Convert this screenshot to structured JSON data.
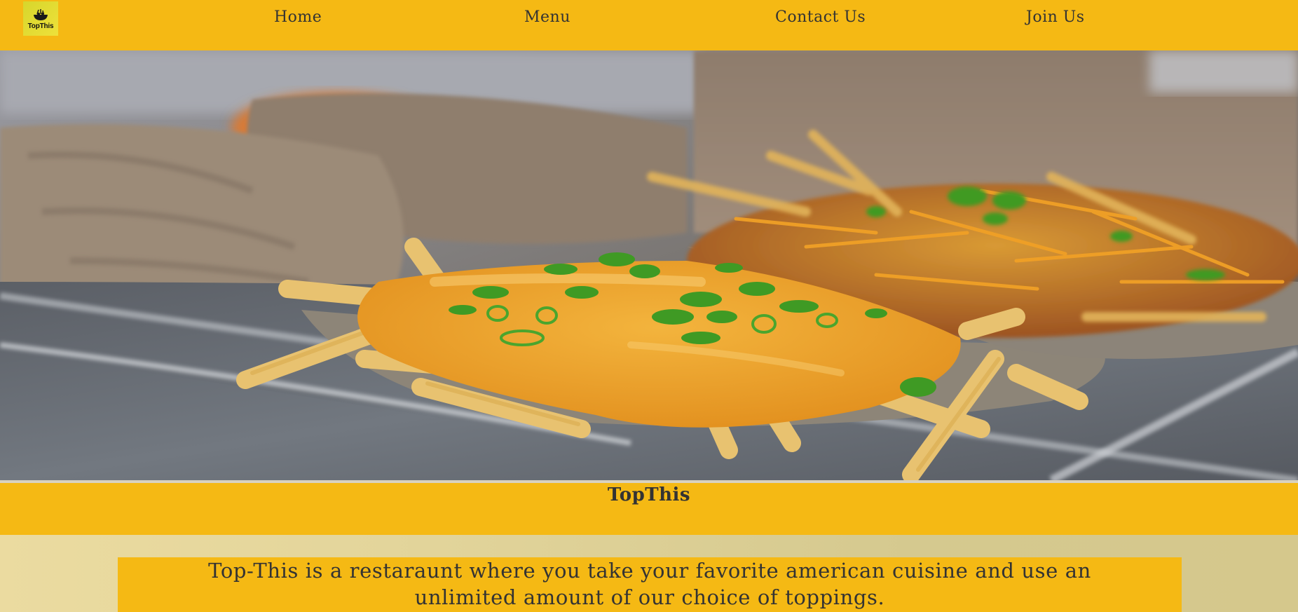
{
  "logo": {
    "text": "TopThis",
    "icon": "bowl-icon"
  },
  "nav": {
    "items": [
      {
        "label": "Home"
      },
      {
        "label": "Menu"
      },
      {
        "label": "Contact Us"
      },
      {
        "label": "Join Us"
      }
    ]
  },
  "hero": {
    "image": "cheese-fries-photo",
    "colors": {
      "tray": "#6f7379",
      "cheese": "#eba12a",
      "fries": "#e8c270",
      "scallion": "#3f9a24",
      "paper": "#9c8b78"
    }
  },
  "brand": {
    "title": "TopThis"
  },
  "about": {
    "text": "Top-This is a restaraunt where you take your favorite american cuisine and use an unlimited amount of our choice of toppings."
  },
  "colors": {
    "accent": "#f5b914",
    "text": "#333333",
    "background_light": "#ebdba0"
  }
}
